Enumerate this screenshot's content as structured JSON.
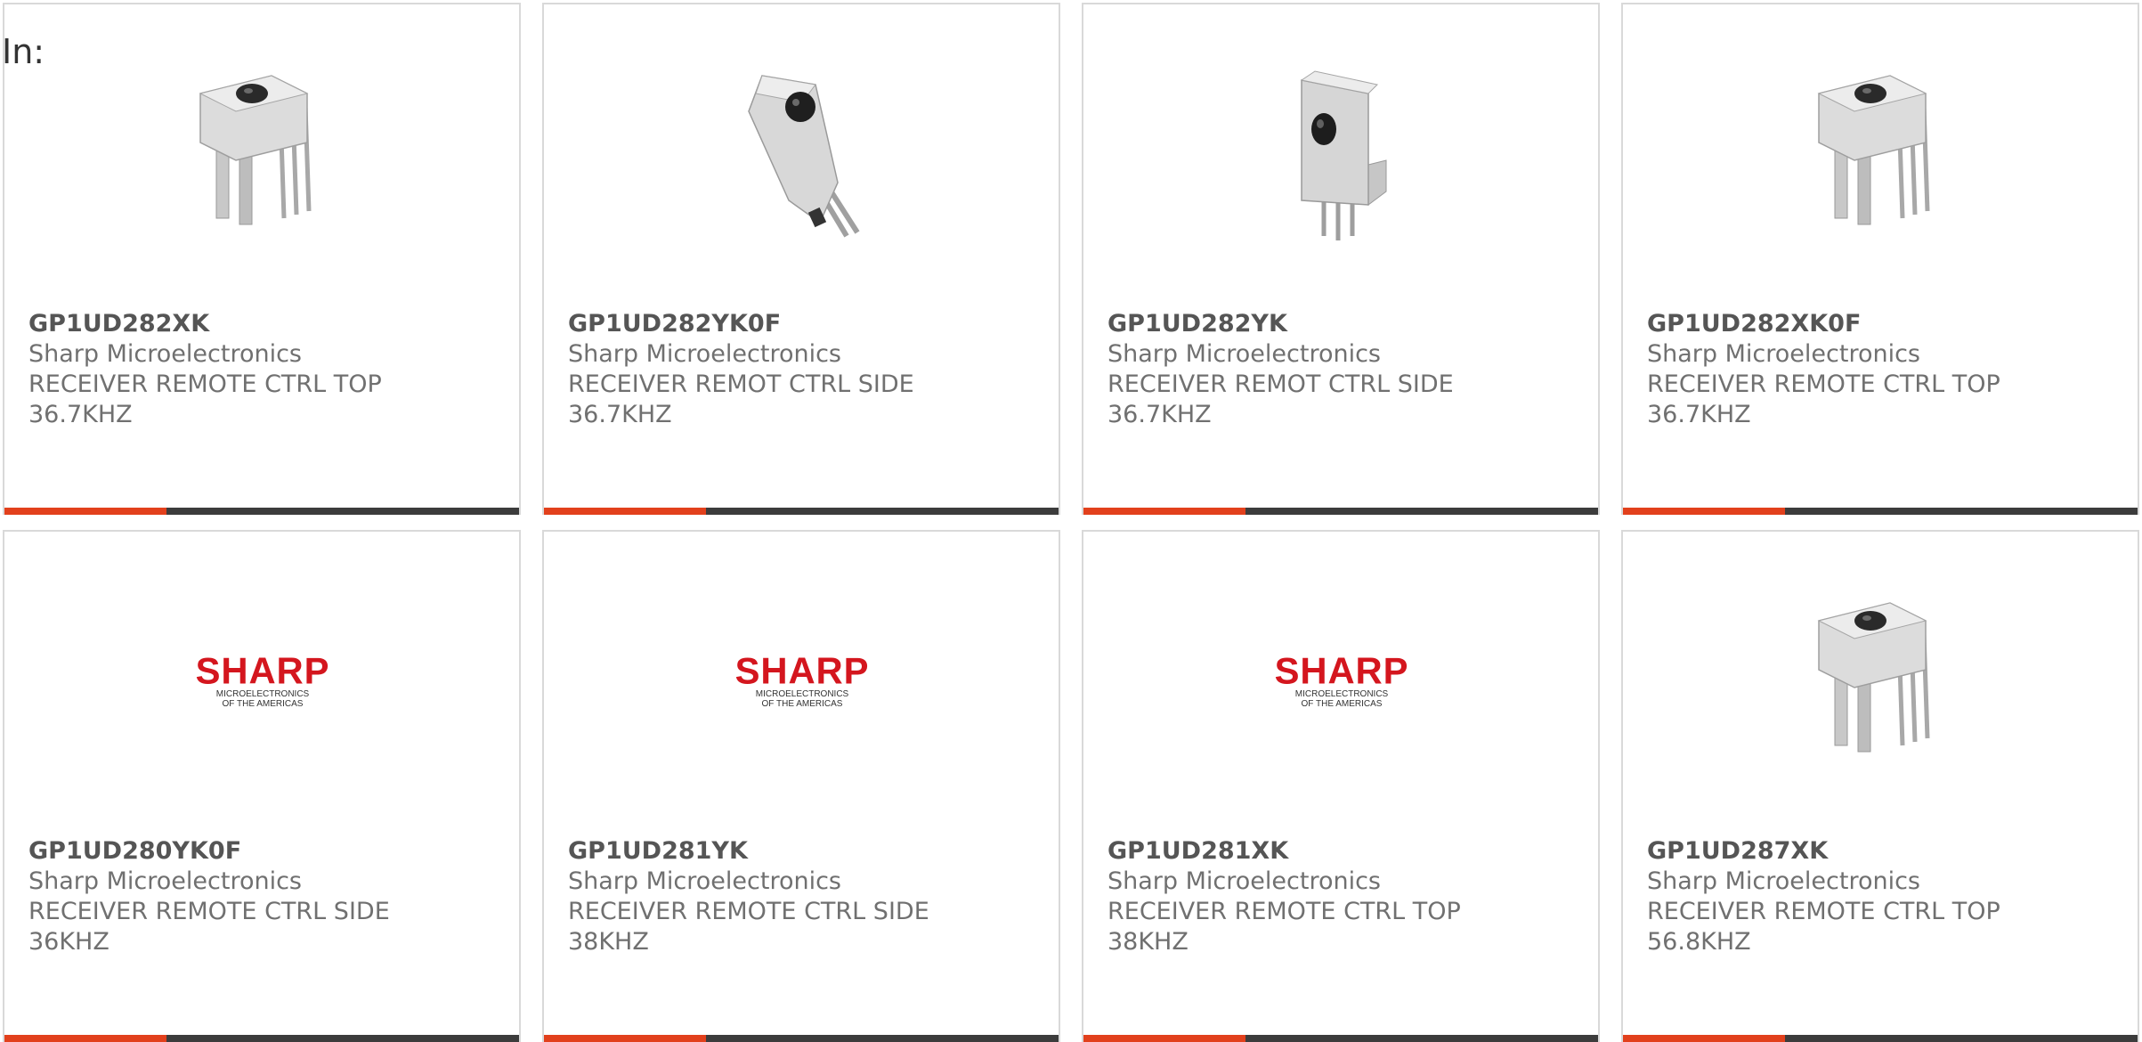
{
  "filter_label": "In:",
  "colors": {
    "accent": "#e2401c",
    "bar": "#3c3c3c",
    "brand_red": "#d4161e"
  },
  "products": [
    {
      "part_number": "GP1UD282XK",
      "manufacturer": "Sharp Microelectronics",
      "desc_line1": "RECEIVER REMOTE CTRL TOP",
      "desc_line2": "36.7KHZ",
      "image": "ir-receiver-top"
    },
    {
      "part_number": "GP1UD282YK0F",
      "manufacturer": "Sharp Microelectronics",
      "desc_line1": "RECEIVER REMOT CTRL SIDE",
      "desc_line2": "36.7KHZ",
      "image": "ir-receiver-side"
    },
    {
      "part_number": "GP1UD282YK",
      "manufacturer": "Sharp Microelectronics",
      "desc_line1": "RECEIVER REMOT CTRL SIDE",
      "desc_line2": "36.7KHZ",
      "image": "ir-receiver-side-upright"
    },
    {
      "part_number": "GP1UD282XK0F",
      "manufacturer": "Sharp Microelectronics",
      "desc_line1": "RECEIVER REMOTE CTRL TOP",
      "desc_line2": "36.7KHZ",
      "image": "ir-receiver-top"
    },
    {
      "part_number": "GP1UD280YK0F",
      "manufacturer": "Sharp Microelectronics",
      "desc_line1": "RECEIVER REMOTE CTRL SIDE",
      "desc_line2": "36KHZ",
      "image": "sharp-logo"
    },
    {
      "part_number": "GP1UD281YK",
      "manufacturer": "Sharp Microelectronics",
      "desc_line1": "RECEIVER REMOTE CTRL SIDE",
      "desc_line2": "38KHZ",
      "image": "sharp-logo"
    },
    {
      "part_number": "GP1UD281XK",
      "manufacturer": "Sharp Microelectronics",
      "desc_line1": "RECEIVER REMOTE CTRL TOP",
      "desc_line2": "38KHZ",
      "image": "sharp-logo"
    },
    {
      "part_number": "GP1UD287XK",
      "manufacturer": "Sharp Microelectronics",
      "desc_line1": "RECEIVER REMOTE CTRL TOP",
      "desc_line2": "56.8KHZ",
      "image": "ir-receiver-top"
    }
  ],
  "logo": {
    "word": "SHARP",
    "line1": "MICROELECTRONICS",
    "line2": "OF THE AMERICAS"
  }
}
